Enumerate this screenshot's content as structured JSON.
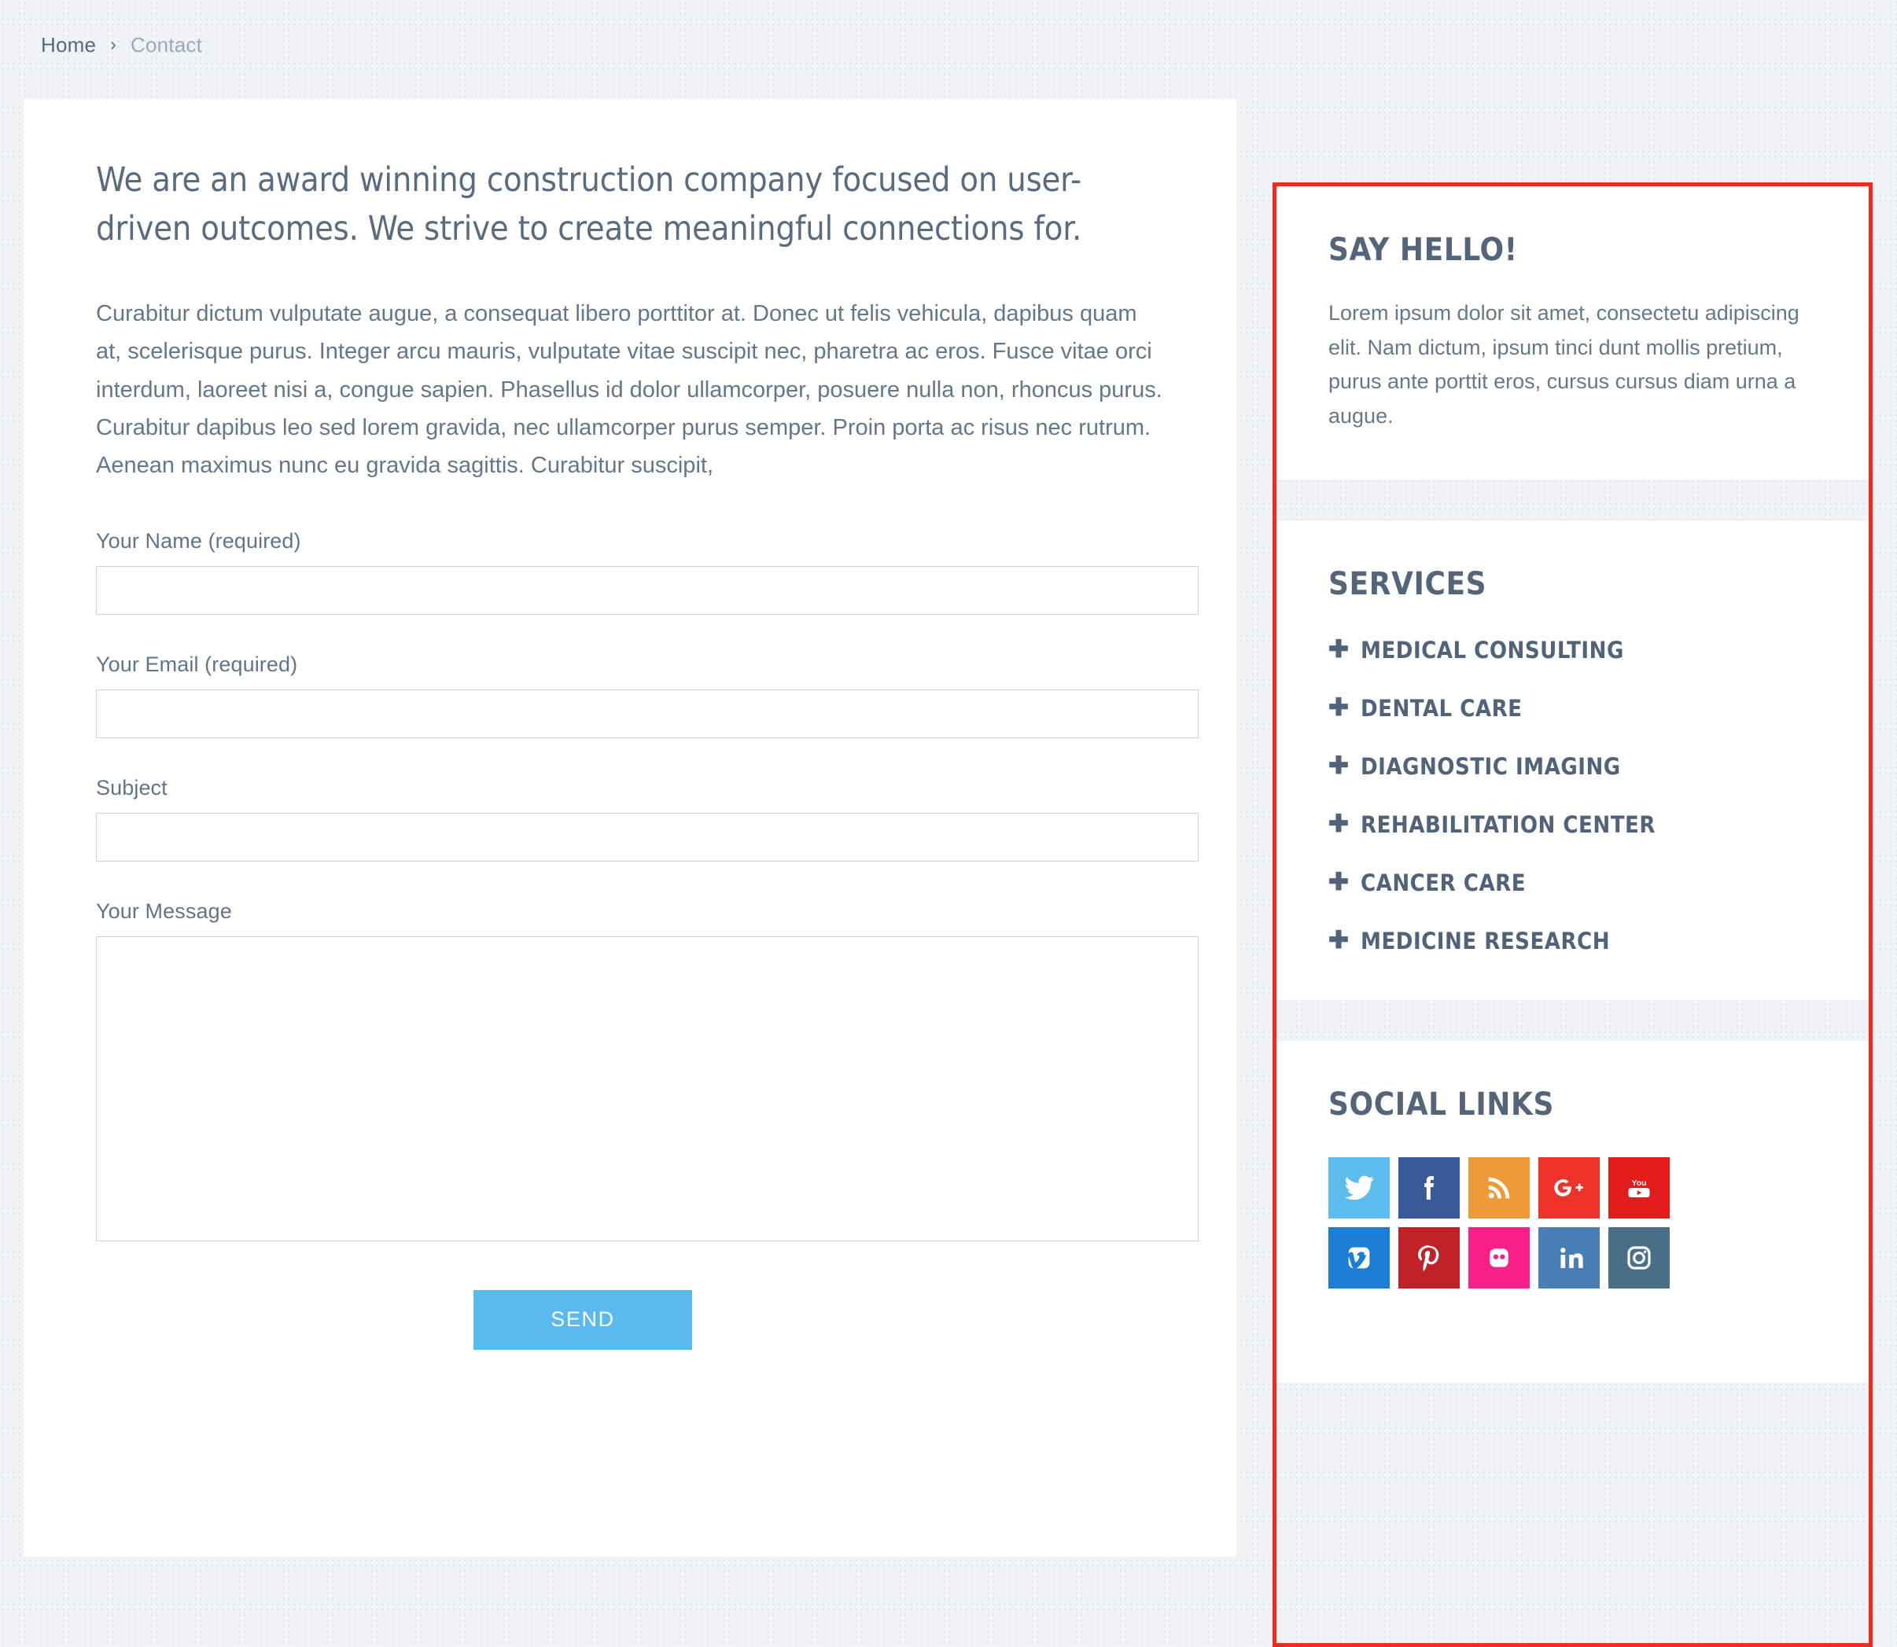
{
  "breadcrumb": {
    "home": "Home",
    "separator": "›",
    "current": "Contact"
  },
  "main": {
    "heading": "We are an award winning construction company focused on user-driven outcomes. We strive to create meaningful connections for.",
    "body": "Curabitur dictum vulputate augue, a consequat libero porttitor at. Donec ut felis vehicula, dapibus quam at, scelerisque purus. Integer arcu mauris, vulputate vitae suscipit nec, pharetra ac eros. Fusce vitae orci interdum, laoreet nisi a, congue sapien. Phasellus id dolor ullamcorper, posuere nulla non, rhoncus purus. Curabitur dapibus leo sed lorem gravida, nec ullamcorper purus semper. Proin porta ac risus nec rutrum. Aenean maximus nunc eu gravida sagittis. Curabitur suscipit,",
    "form": {
      "name_label": "Your Name (required)",
      "name_value": "",
      "name_placeholder": "",
      "email_label": "Your Email (required)",
      "email_value": "",
      "email_placeholder": "",
      "subject_label": "Subject",
      "subject_value": "",
      "subject_placeholder": "",
      "message_label": "Your Message",
      "message_value": "",
      "message_placeholder": "",
      "send_label": "SEND"
    }
  },
  "sidebar": {
    "highlight_color": "#f42a1b",
    "say_hello": {
      "title": "SAY HELLO!",
      "text": "Lorem ipsum dolor sit amet, consectetu adipiscing elit. Nam dictum, ipsum tinci dunt mollis pretium, purus ante porttit eros, cursus cursus diam urna a augue."
    },
    "services": {
      "title": "SERVICES",
      "bullet": "✚",
      "items": [
        {
          "label": "MEDICAL CONSULTING"
        },
        {
          "label": "DENTAL CARE"
        },
        {
          "label": "DIAGNOSTIC IMAGING"
        },
        {
          "label": "REHABILITATION CENTER"
        },
        {
          "label": "CANCER CARE"
        },
        {
          "label": "MEDICINE RESEARCH"
        }
      ]
    },
    "social": {
      "title": "SOCIAL LINKS",
      "items": [
        {
          "name": "twitter",
          "icon": "twitter-icon",
          "color": "#5bbced"
        },
        {
          "name": "facebook",
          "icon": "facebook-icon",
          "color": "#3b5998"
        },
        {
          "name": "rss",
          "icon": "rss-icon",
          "color": "#ef9a39"
        },
        {
          "name": "googleplus",
          "icon": "google-plus-icon",
          "color": "#ee3129"
        },
        {
          "name": "youtube",
          "icon": "youtube-icon",
          "color": "#e41b1b"
        },
        {
          "name": "vimeo",
          "icon": "vimeo-icon",
          "color": "#1b7fd6"
        },
        {
          "name": "pinterest",
          "icon": "pinterest-icon",
          "color": "#c12228"
        },
        {
          "name": "flickr",
          "icon": "flickr-icon",
          "color": "#fb2087"
        },
        {
          "name": "linkedin",
          "icon": "linkedin-icon",
          "color": "#4a7fb5"
        },
        {
          "name": "instagram",
          "icon": "instagram-icon",
          "color": "#4a7089"
        }
      ]
    }
  },
  "theme": {
    "accent": "#5ab9ef",
    "text": "#5b6b7f",
    "heading": "#54657a",
    "background": "#f1f4f7",
    "card": "#ffffff",
    "border": "#cdd3da"
  }
}
